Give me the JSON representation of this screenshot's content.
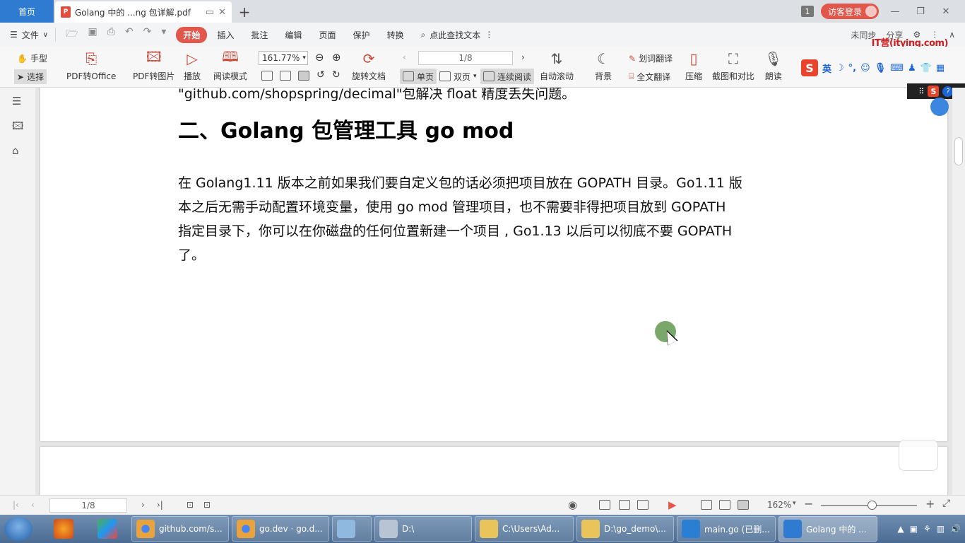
{
  "tabbar": {
    "home_label": "首页",
    "doc_tab_title": "Golang 中的 ...ng 包详解.pdf",
    "doc_icon": "P",
    "count_badge": "1",
    "login_label": "访客登录"
  },
  "menubar": {
    "file_label": "文件",
    "tabs": [
      "开始",
      "插入",
      "批注",
      "编辑",
      "页面",
      "保护",
      "转换"
    ],
    "search_label": "点此查找文本",
    "right_items": [
      "未同步",
      "分享"
    ],
    "watermark": "IT营(itying.com)"
  },
  "ribbon": {
    "hand": "手型",
    "select": "选择",
    "pdf_office": "PDF转Office",
    "pdf_image": "PDF转图片",
    "play": "播放",
    "read_mode": "阅读模式",
    "zoom": "161.77%",
    "page": "1/8",
    "rotate": "旋转文档",
    "single": "单页",
    "double": "双页",
    "continuous": "连续阅读",
    "auto_scroll": "自动滚动",
    "background": "背景",
    "word_translate": "划词翻译",
    "full_translate": "全文翻译",
    "compress": "压缩",
    "screenshot_compare": "截图和对比",
    "read_aloud": "朗读",
    "ime_lang": "英"
  },
  "document": {
    "line1": "\"github.com/shopspring/decimal\"包解决 float 精度丢失问题。",
    "heading": "二、Golang 包管理工具  go mod",
    "body_lines": [
      "在 Golang1.11 版本之前如果我们要自定义包的话必须把项目放在 GOPATH 目录。Go1.11 版",
      "本之后无需手动配置环境变量，使用 go mod  管理项目，也不需要非得把项目放到 GOPATH",
      "指定目录下，你可以在你磁盘的任何位置新建一个项目 , Go1.13 以后可以彻底不要 GOPATH",
      "了。"
    ]
  },
  "statusbar": {
    "page": "1/8",
    "zoom": "162%"
  },
  "taskbar": {
    "tasks": [
      {
        "label": "github.com/s...",
        "icon": "chrome-icon",
        "color": "#e8a33d"
      },
      {
        "label": "go.dev · go.d...",
        "icon": "chrome-icon",
        "color": "#e8a33d"
      },
      {
        "label": "",
        "icon": "notepad-icon",
        "color": "#8fb9df"
      },
      {
        "label": "D:\\",
        "icon": "drive-icon",
        "color": "#b8c4d4"
      },
      {
        "label": "C:\\Users\\Ad...",
        "icon": "folder-icon",
        "color": "#e9c45b"
      },
      {
        "label": "D:\\go_demo\\...",
        "icon": "folder-icon",
        "color": "#e9c45b"
      },
      {
        "label": "main.go (已删...",
        "icon": "vscode-icon",
        "color": "#2b7fd3"
      },
      {
        "label": "Golang 中的 ...",
        "icon": "wps-pdf-icon",
        "color": "#2e7bd1"
      }
    ]
  },
  "colors": {
    "accent_red": "#e1574c",
    "home_blue": "#2e7bd1"
  }
}
